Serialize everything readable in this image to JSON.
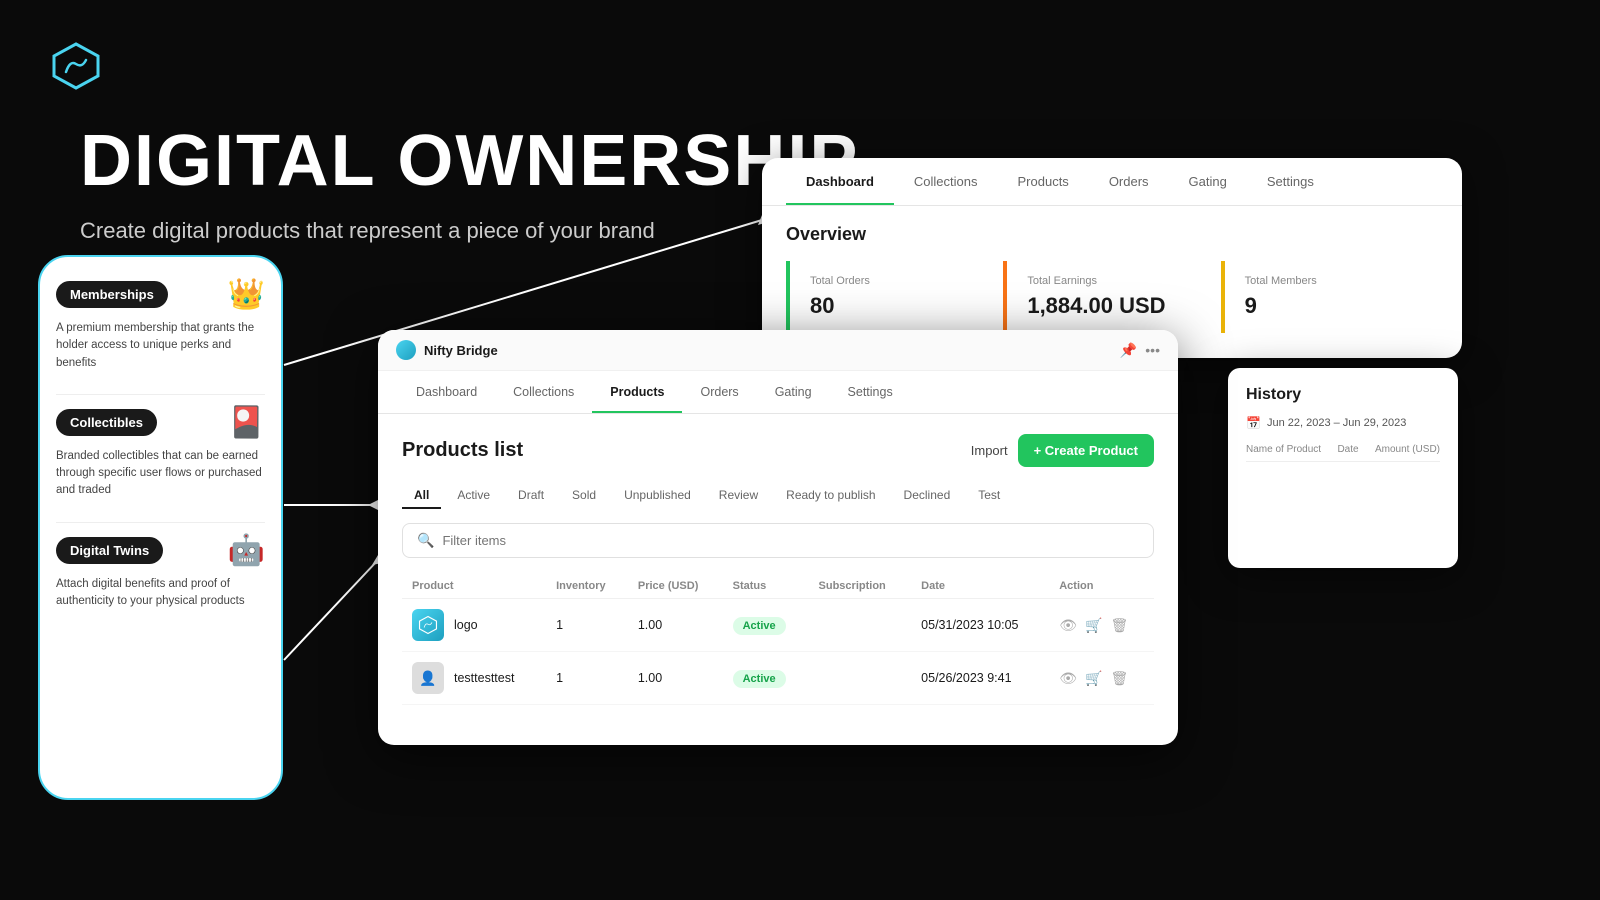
{
  "logo": {
    "alt": "Nifty Bridge Logo"
  },
  "hero": {
    "title": "DIGITAL OWNERSHIP",
    "subtitle": "Create digital products that represent a piece of your brand"
  },
  "phone": {
    "items": [
      {
        "badge": "Memberships",
        "icon": "👑",
        "description": "A premium membership that grants the holder access to unique perks and benefits"
      },
      {
        "badge": "Collectibles",
        "icon": "🎴",
        "description": "Branded collectibles that can be earned through specific user flows or purchased and traded"
      },
      {
        "badge": "Digital Twins",
        "icon": "🤖",
        "description": "Attach digital benefits and proof of authenticity to your physical products"
      }
    ]
  },
  "dashboard_back": {
    "nav_items": [
      "Dashboard",
      "Collections",
      "Products",
      "Orders",
      "Gating",
      "Settings"
    ],
    "active_nav": "Dashboard",
    "overview_title": "Overview",
    "cards": [
      {
        "label": "Total Orders",
        "value": "80"
      },
      {
        "label": "Total Earnings",
        "value": "1,884.00 USD"
      },
      {
        "label": "Total Members",
        "value": "9"
      }
    ]
  },
  "history": {
    "title": "History",
    "date_range": "Jun 22, 2023 – Jun 29, 2023",
    "columns": [
      "Name of Product",
      "Date",
      "Amount (USD)"
    ],
    "sort_icon": "↓"
  },
  "products_panel": {
    "window_title": "Nifty Bridge",
    "nav_items": [
      "Dashboard",
      "Collections",
      "Products",
      "Orders",
      "Gating",
      "Settings"
    ],
    "active_nav": "Products",
    "list_title": "Products list",
    "import_label": "Import",
    "create_label": "+ Create Product",
    "filter_tabs": [
      "All",
      "Active",
      "Draft",
      "Sold",
      "Unpublished",
      "Review",
      "Ready to publish",
      "Declined",
      "Test"
    ],
    "active_filter": "All",
    "search_placeholder": "Filter items",
    "table": {
      "columns": [
        "Product",
        "Inventory",
        "Price (USD)",
        "Status",
        "Subscription",
        "Date",
        "Action"
      ],
      "rows": [
        {
          "name": "logo",
          "avatar_type": "brand",
          "inventory": "1",
          "price": "1.00",
          "status": "Active",
          "subscription": "",
          "date": "05/31/2023 10:05"
        },
        {
          "name": "testtesttest",
          "avatar_type": "grey",
          "inventory": "1",
          "price": "1.00",
          "status": "Active",
          "subscription": "",
          "date": "05/26/2023 9:41"
        }
      ]
    }
  }
}
